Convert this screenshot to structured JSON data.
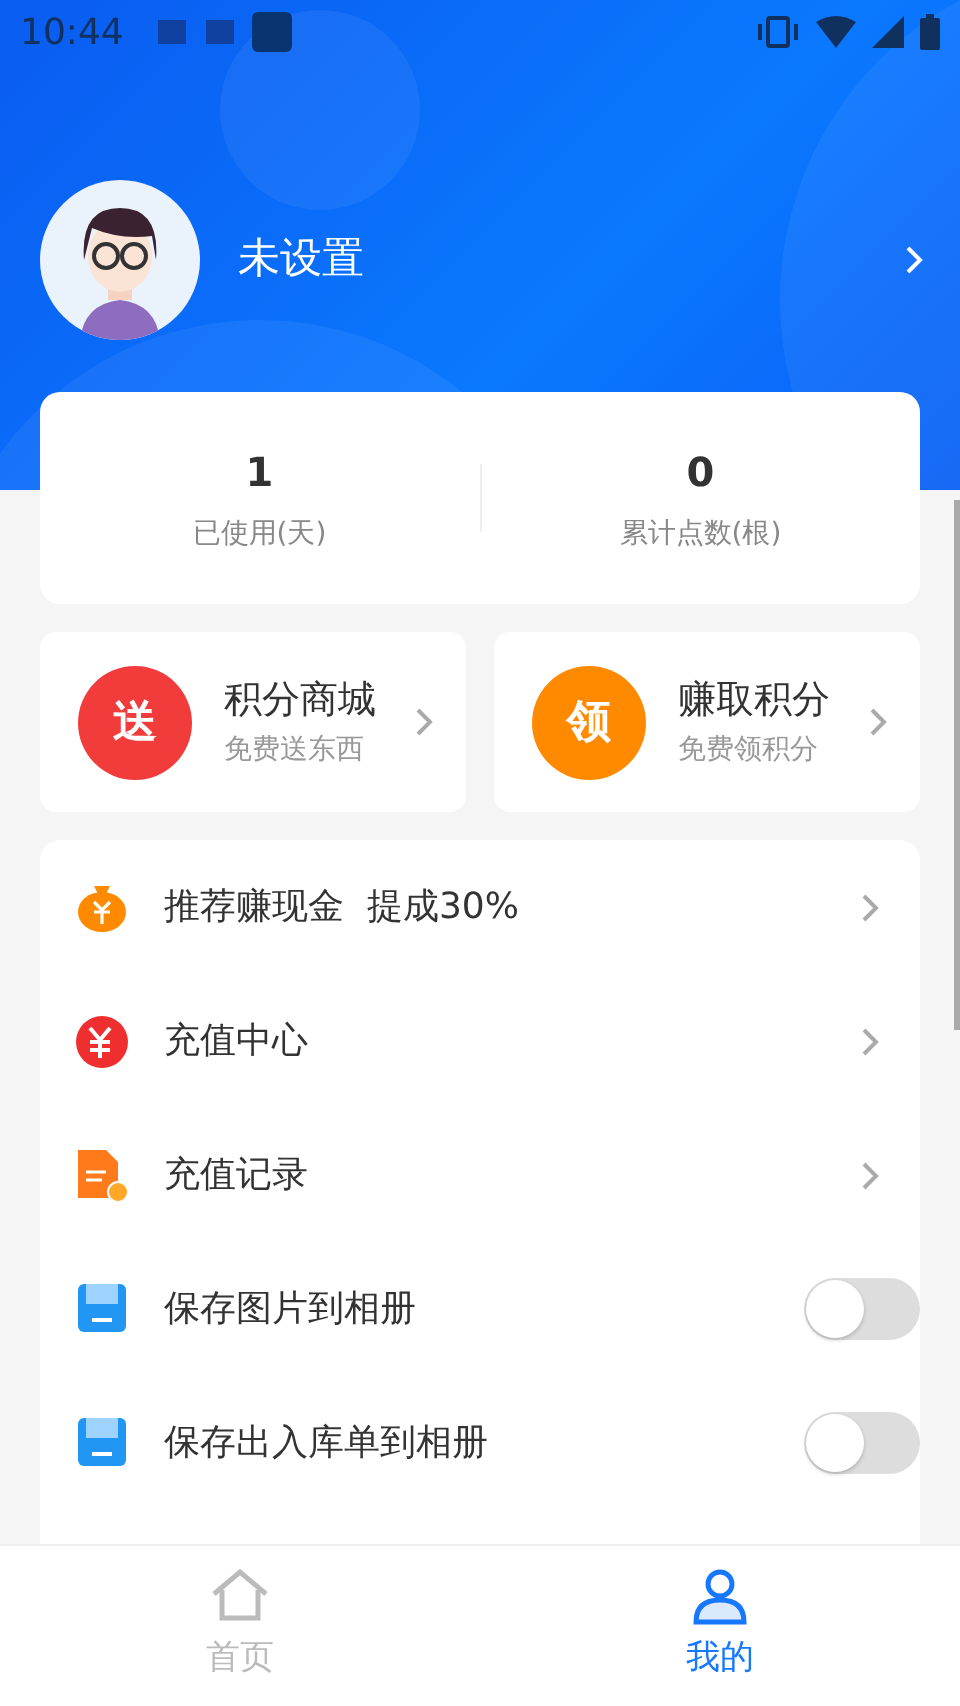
{
  "status_bar": {
    "time": "10:44"
  },
  "profile": {
    "name": "未设置"
  },
  "stats": [
    {
      "value": "1",
      "label": "已使用(天)"
    },
    {
      "value": "0",
      "label": "累计点数(根)"
    }
  ],
  "shortcuts": [
    {
      "badge": "送",
      "title": "积分商城",
      "subtitle": "免费送东西",
      "color": "#f23b3b"
    },
    {
      "badge": "领",
      "title": "赚取积分",
      "subtitle": "免费领积分",
      "color": "#ff8a00"
    }
  ],
  "menu": [
    {
      "kind": "link",
      "label": "推荐赚现金  提成30%"
    },
    {
      "kind": "link",
      "label": "充值中心"
    },
    {
      "kind": "link",
      "label": "充值记录"
    },
    {
      "kind": "toggle",
      "label": "保存图片到相册",
      "on": false
    },
    {
      "kind": "toggle",
      "label": "保存出入库单到相册",
      "on": false
    }
  ],
  "tab_bar": [
    {
      "label": "首页",
      "selected": false
    },
    {
      "label": "我的",
      "selected": true
    }
  ]
}
